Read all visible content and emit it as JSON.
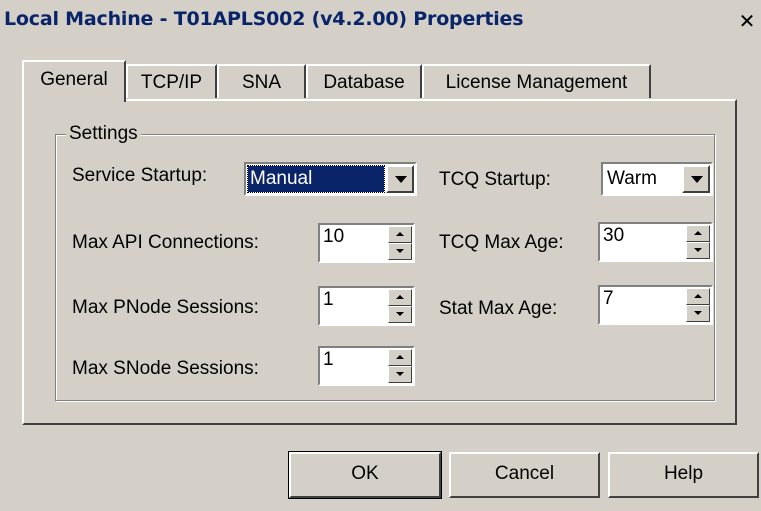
{
  "window": {
    "title": "Local Machine - T01APLS002 (v4.2.00) Properties",
    "close_glyph": "✕"
  },
  "tabs": [
    {
      "label": "General",
      "active": true
    },
    {
      "label": "TCP/IP",
      "active": false
    },
    {
      "label": "SNA",
      "active": false
    },
    {
      "label": "Database",
      "active": false
    },
    {
      "label": "License Management",
      "active": false
    }
  ],
  "settings": {
    "group_label": "Settings",
    "service_startup": {
      "label": "Service Startup:",
      "value": "Manual"
    },
    "max_api_connections": {
      "label": "Max API Connections:",
      "value": "10"
    },
    "max_pnode_sessions": {
      "label": "Max PNode Sessions:",
      "value": "1"
    },
    "max_snode_sessions": {
      "label": "Max SNode Sessions:",
      "value": "1"
    },
    "tcq_startup": {
      "label": "TCQ Startup:",
      "value": "Warm"
    },
    "tcq_max_age": {
      "label": "TCQ Max Age:",
      "value": "30"
    },
    "stat_max_age": {
      "label": "Stat Max Age:",
      "value": "7"
    }
  },
  "buttons": {
    "ok": "OK",
    "cancel": "Cancel",
    "help": "Help"
  },
  "colors": {
    "face": "#d4d0c8",
    "title_text": "#0a246a",
    "selection": "#0a246a"
  },
  "icons": [
    "close-icon",
    "dropdown-arrow-icon",
    "spin-up-icon",
    "spin-down-icon"
  ]
}
